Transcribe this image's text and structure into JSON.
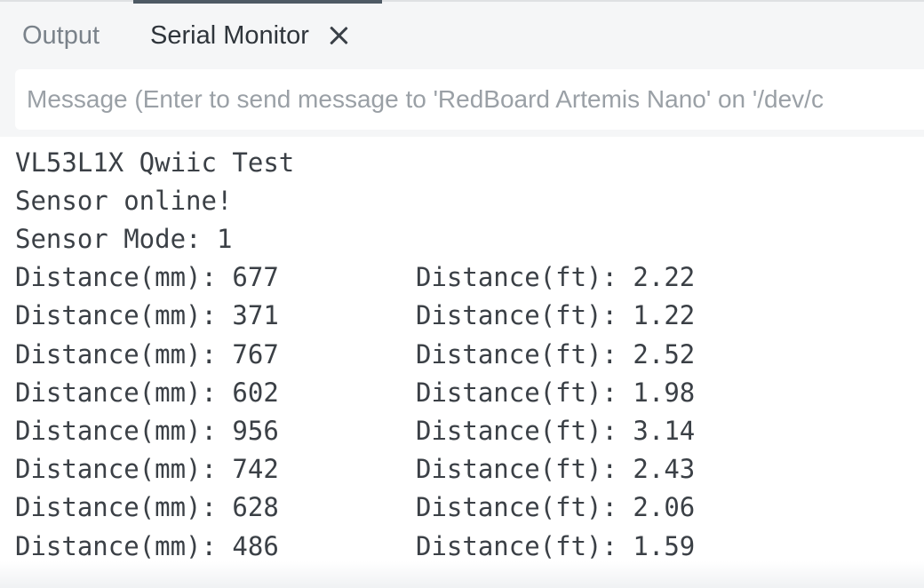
{
  "tabs": {
    "output_label": "Output",
    "serial_label": "Serial Monitor"
  },
  "message_input": {
    "placeholder": "Message (Enter to send message to 'RedBoard Artemis Nano' on '/dev/c",
    "value": ""
  },
  "serial_output": {
    "header_lines": [
      "VL53L1X Qwiic Test",
      "Sensor online!",
      "Sensor Mode: 1"
    ],
    "readings": [
      {
        "mm": "Distance(mm): 677",
        "ft": "Distance(ft): 2.22"
      },
      {
        "mm": "Distance(mm): 371",
        "ft": "Distance(ft): 1.22"
      },
      {
        "mm": "Distance(mm): 767",
        "ft": "Distance(ft): 2.52"
      },
      {
        "mm": "Distance(mm): 602",
        "ft": "Distance(ft): 1.98"
      },
      {
        "mm": "Distance(mm): 956",
        "ft": "Distance(ft): 3.14"
      },
      {
        "mm": "Distance(mm): 742",
        "ft": "Distance(ft): 2.43"
      },
      {
        "mm": "Distance(mm): 628",
        "ft": "Distance(ft): 2.06"
      },
      {
        "mm": "Distance(mm): 486",
        "ft": "Distance(ft): 1.59"
      }
    ]
  },
  "icons": {
    "close_tab": "close-icon"
  },
  "colors": {
    "panel_background": "#f5f6f7",
    "active_tab_indicator": "#4e5a64",
    "text": "#3b4046",
    "muted_text": "#7a828a"
  }
}
